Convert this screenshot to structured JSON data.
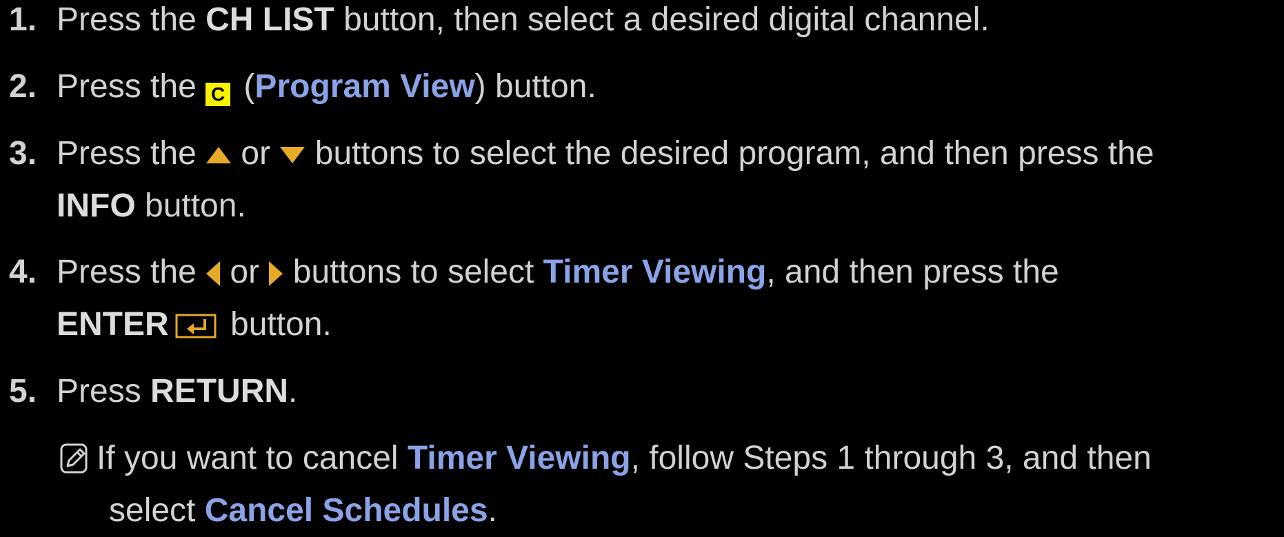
{
  "colors": {
    "background": "#000000",
    "text": "#d2d2d2",
    "highlight": "#8aa2e6",
    "accent": "#e6aa28",
    "yellow_button": "#f6f200"
  },
  "steps": [
    {
      "number": "1.",
      "parts": [
        "Press the ",
        "CH LIST",
        " button, then select a desired digital channel."
      ]
    },
    {
      "number": "2.",
      "parts": [
        "Press the ",
        "C",
        " (",
        "Program View",
        ") button."
      ]
    },
    {
      "number": "3.",
      "line1": [
        "Press the ",
        " or ",
        " buttons to select the desired program, and then press the"
      ],
      "line2": [
        "INFO",
        " button."
      ],
      "icons": [
        "up-arrow-icon",
        "down-arrow-icon"
      ]
    },
    {
      "number": "4.",
      "line1": [
        "Press the ",
        " or ",
        " buttons to select ",
        "Timer Viewing",
        ", and then press the"
      ],
      "line2": [
        "ENTER",
        " button."
      ],
      "icons": [
        "left-arrow-icon",
        "right-arrow-icon",
        "enter-icon"
      ]
    },
    {
      "number": "5.",
      "parts": [
        "Press ",
        "RETURN",
        "."
      ]
    }
  ],
  "note": {
    "icon": "note-icon",
    "line1": [
      "If you want to cancel ",
      "Timer Viewing",
      ", follow Steps 1 through 3, and then"
    ],
    "line2": [
      "select ",
      "Cancel Schedules",
      "."
    ]
  }
}
